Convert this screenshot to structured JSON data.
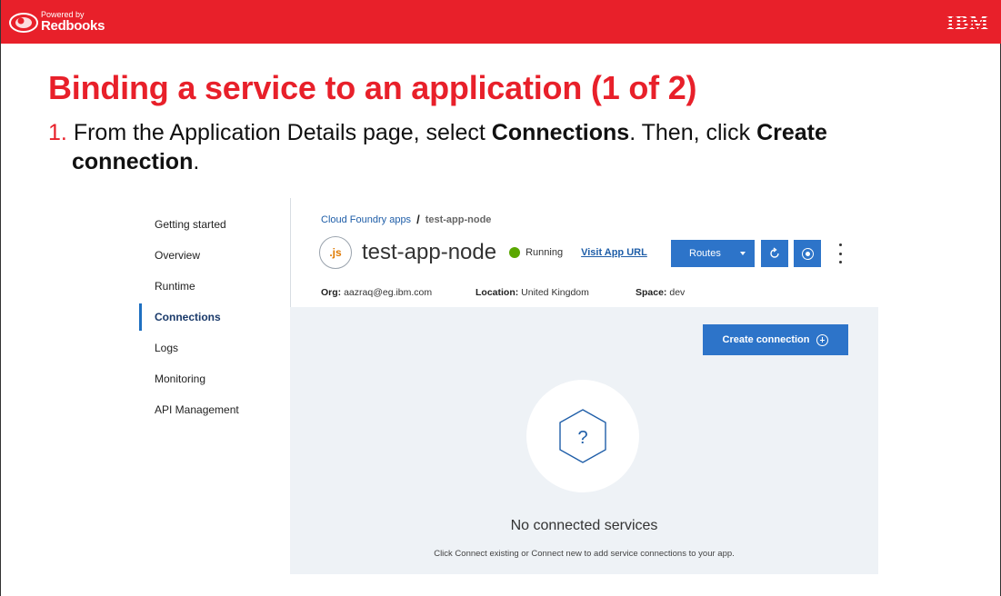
{
  "header": {
    "logo_powered": "Powered by",
    "logo_brand": "Redbooks",
    "ibm_logo": "IBM"
  },
  "slide": {
    "title": "Binding a service to an application (1 of 2)",
    "step_number": "1.",
    "step_text_1": "From the Application Details page, select ",
    "step_bold_1": "Connections",
    "step_text_2": ". Then, click ",
    "step_bold_2": "Create",
    "step_bold_3": "connection",
    "step_text_3": "."
  },
  "sidebar": {
    "items": [
      {
        "label": "Getting started"
      },
      {
        "label": "Overview"
      },
      {
        "label": "Runtime"
      },
      {
        "label": "Connections"
      },
      {
        "label": "Logs"
      },
      {
        "label": "Monitoring"
      },
      {
        "label": "API Management"
      }
    ],
    "active": "Connections"
  },
  "breadcrumb": {
    "parent": "Cloud Foundry apps",
    "separator": "/",
    "current": "test-app-node"
  },
  "app": {
    "badge": ".js",
    "name": "test-app-node",
    "status": "Running",
    "status_color": "#5aa700",
    "visit_link": "Visit App URL",
    "routes_label": "Routes"
  },
  "meta": {
    "org_label": "Org:",
    "org_value": "aazraq@eg.ibm.com",
    "location_label": "Location:",
    "location_value": "United Kingdom",
    "space_label": "Space:",
    "space_value": "dev"
  },
  "connections": {
    "create_label": "Create connection",
    "empty_icon": "?",
    "empty_title": "No connected services",
    "empty_sub": "Click Connect existing or Connect new to add service connections to your app."
  },
  "colors": {
    "brand_red": "#e8202a",
    "button_blue": "#2d74c9"
  }
}
